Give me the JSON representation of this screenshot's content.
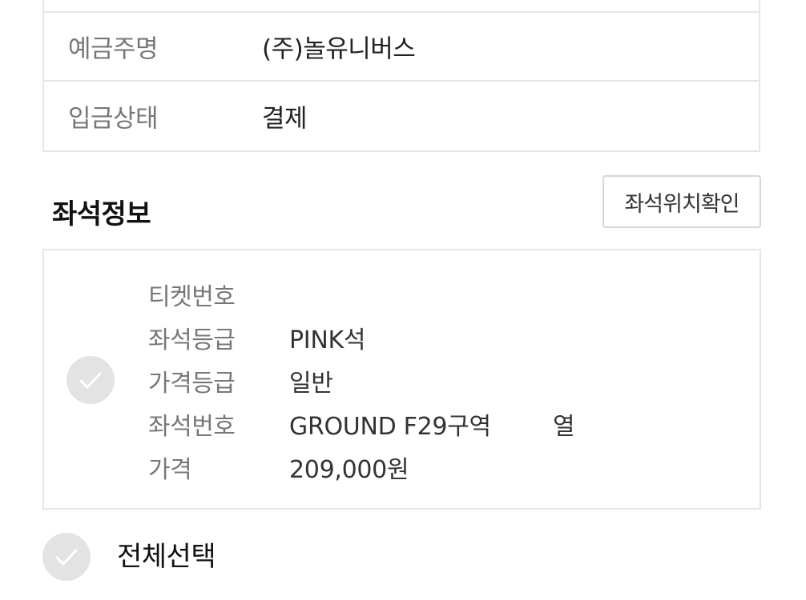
{
  "payment_info": {
    "rows": [
      {
        "label": "예금주명",
        "value": "(주)놀유니버스"
      },
      {
        "label": "입금상태",
        "value": "결제"
      }
    ]
  },
  "seat_section": {
    "title": "좌석정보",
    "location_button_label": "좌석위치확인",
    "ticket": {
      "checked": false,
      "fields": [
        {
          "label": "티켓번호",
          "value": ""
        },
        {
          "label": "좌석등급",
          "value": "PINK석"
        },
        {
          "label": "가격등급",
          "value": "일반"
        },
        {
          "label": "좌석번호",
          "value": "GROUND F29구역",
          "suffix": "열"
        },
        {
          "label": "가격",
          "value": "209,000원"
        }
      ]
    }
  },
  "select_all": {
    "label": "전체선택",
    "checked": false
  },
  "colors": {
    "border": "#e6e6e6",
    "label_text": "#777777",
    "value_text": "#222222",
    "check_bg": "#e3e3e3"
  },
  "icons": {
    "checkbox": "check-icon"
  }
}
